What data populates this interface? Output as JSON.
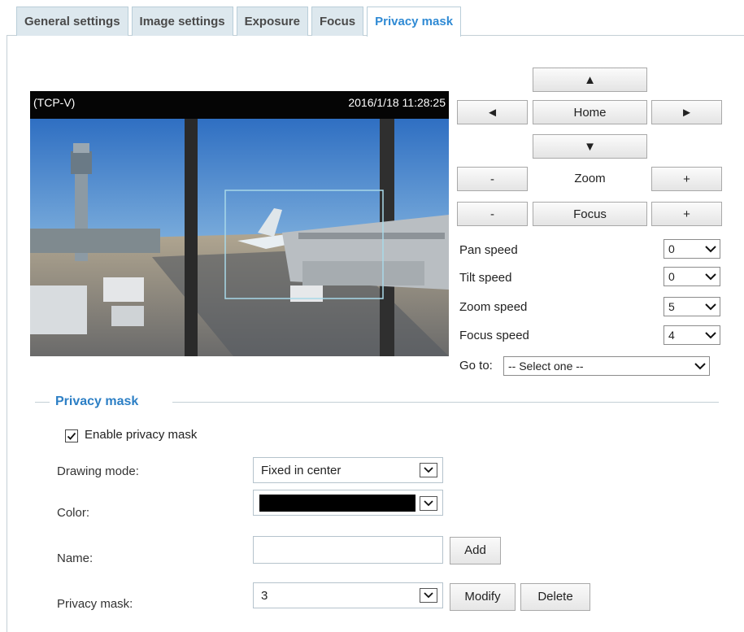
{
  "tabs": [
    "General settings",
    "Image settings",
    "Exposure",
    "Focus",
    "Privacy mask"
  ],
  "active_tab": "Privacy mask",
  "video": {
    "stream_label": "(TCP-V)",
    "timestamp": "2016/1/18 11:28:25"
  },
  "ptz": {
    "up": "▲",
    "left": "◄",
    "home": "Home",
    "right": "►",
    "down": "▼",
    "zoom_minus": "-",
    "zoom_label": "Zoom",
    "zoom_plus": "+",
    "focus_minus": "-",
    "focus_label": "Focus",
    "focus_plus": "+",
    "speeds": [
      {
        "label": "Pan speed",
        "value": "0"
      },
      {
        "label": "Tilt speed",
        "value": "0"
      },
      {
        "label": "Zoom speed",
        "value": "5"
      },
      {
        "label": "Focus speed",
        "value": "4"
      }
    ],
    "goto_label": "Go to:",
    "goto_value": "-- Select one --"
  },
  "privacy": {
    "section_title": "Privacy mask",
    "enable_label": "Enable privacy mask",
    "enable_checked": true,
    "drawing_mode_label": "Drawing mode:",
    "drawing_mode_value": "Fixed in center",
    "color_label": "Color:",
    "color_value": "#000000",
    "name_label": "Name:",
    "name_value": "",
    "add_button": "Add",
    "mask_label": "Privacy mask:",
    "mask_value": "3",
    "modify_button": "Modify",
    "delete_button": "Delete"
  },
  "colors": {
    "accent": "#2f8ad4",
    "tab_bg": "#dde8ee",
    "mask_outline": "#a8d8e8"
  }
}
